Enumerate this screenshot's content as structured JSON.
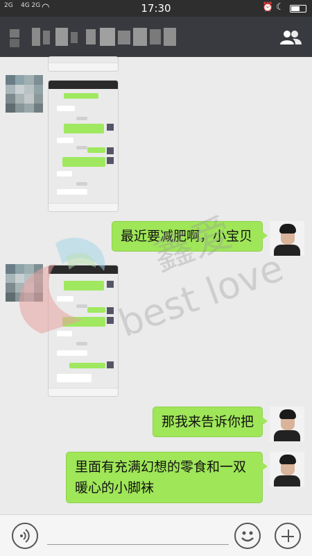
{
  "statusbar": {
    "signal_1": "2G",
    "signal_2": "4G 2G",
    "time": "17:30"
  },
  "messages": [
    {
      "from": "contact",
      "type": "image",
      "description": "chat screenshot"
    },
    {
      "from": "me",
      "type": "text",
      "text": "最近要减肥啊，小宝贝"
    },
    {
      "from": "contact",
      "type": "image",
      "description": "chat screenshot"
    },
    {
      "from": "me",
      "type": "text",
      "text": "那我来告诉你把"
    },
    {
      "from": "me",
      "type": "text",
      "text": "里面有充满幻想的零食和一双暖心的小脚袜"
    }
  ],
  "bubble_lines": {
    "m1": "最近要减肥啊，小宝贝",
    "m2": "那我来告诉你把",
    "m3_line1": "里面有充满幻想的零食和一双",
    "m3_line2": "暖心的小脚袜"
  },
  "watermark": {
    "text_cn": "鑫爱",
    "text_en": "best love"
  },
  "icons": {
    "header_right": "contacts-group-icon",
    "input_left": "voice-icon",
    "input_emoji": "emoji-icon",
    "input_more": "plus-icon"
  },
  "colors": {
    "titlebar": "#393a3f",
    "bubble_green": "#9fe658",
    "chat_bg": "#ebebeb"
  }
}
